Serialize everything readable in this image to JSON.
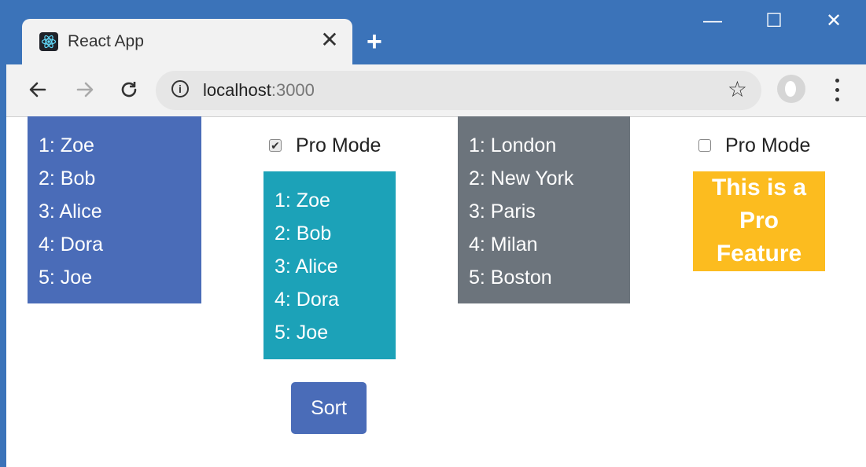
{
  "browser": {
    "tab_title": "React App",
    "tab_close": "✕",
    "new_tab": "+",
    "url_host": "localhost",
    "url_port": ":3000",
    "icons": {
      "favicon": "react-icon",
      "back": "back-arrow-icon",
      "forward": "forward-arrow-icon",
      "reload": "reload-icon",
      "info": "info-icon",
      "star": "star-icon",
      "profile": "profile-icon",
      "menu": "more-vert-icon"
    },
    "window_controls": {
      "minimize": "—",
      "maximize": "☐",
      "close": "✕"
    },
    "colors": {
      "frame": "#3b73b9",
      "toolbar": "#f2f2f2"
    }
  },
  "page": {
    "names_list_1": [
      "1: Zoe",
      "2: Bob",
      "3: Alice",
      "4: Dora",
      "5: Joe"
    ],
    "pro_mode_1": {
      "label": "Pro Mode",
      "checked": true
    },
    "names_list_2": [
      "1: Zoe",
      "2: Bob",
      "3: Alice",
      "4: Dora",
      "5: Joe"
    ],
    "sort_button": "Sort",
    "cities_list": [
      "1: London",
      "2: New York",
      "3: Paris",
      "4: Milan",
      "5: Boston"
    ],
    "pro_mode_2": {
      "label": "Pro Mode",
      "checked": false
    },
    "pro_feature_lines": [
      "This is a",
      "Pro",
      "Feature"
    ],
    "colors": {
      "primary": "#4a6cb8",
      "info": "#1ca2b8",
      "secondary": "#6c747c",
      "warning": "#fcbc1f"
    }
  }
}
